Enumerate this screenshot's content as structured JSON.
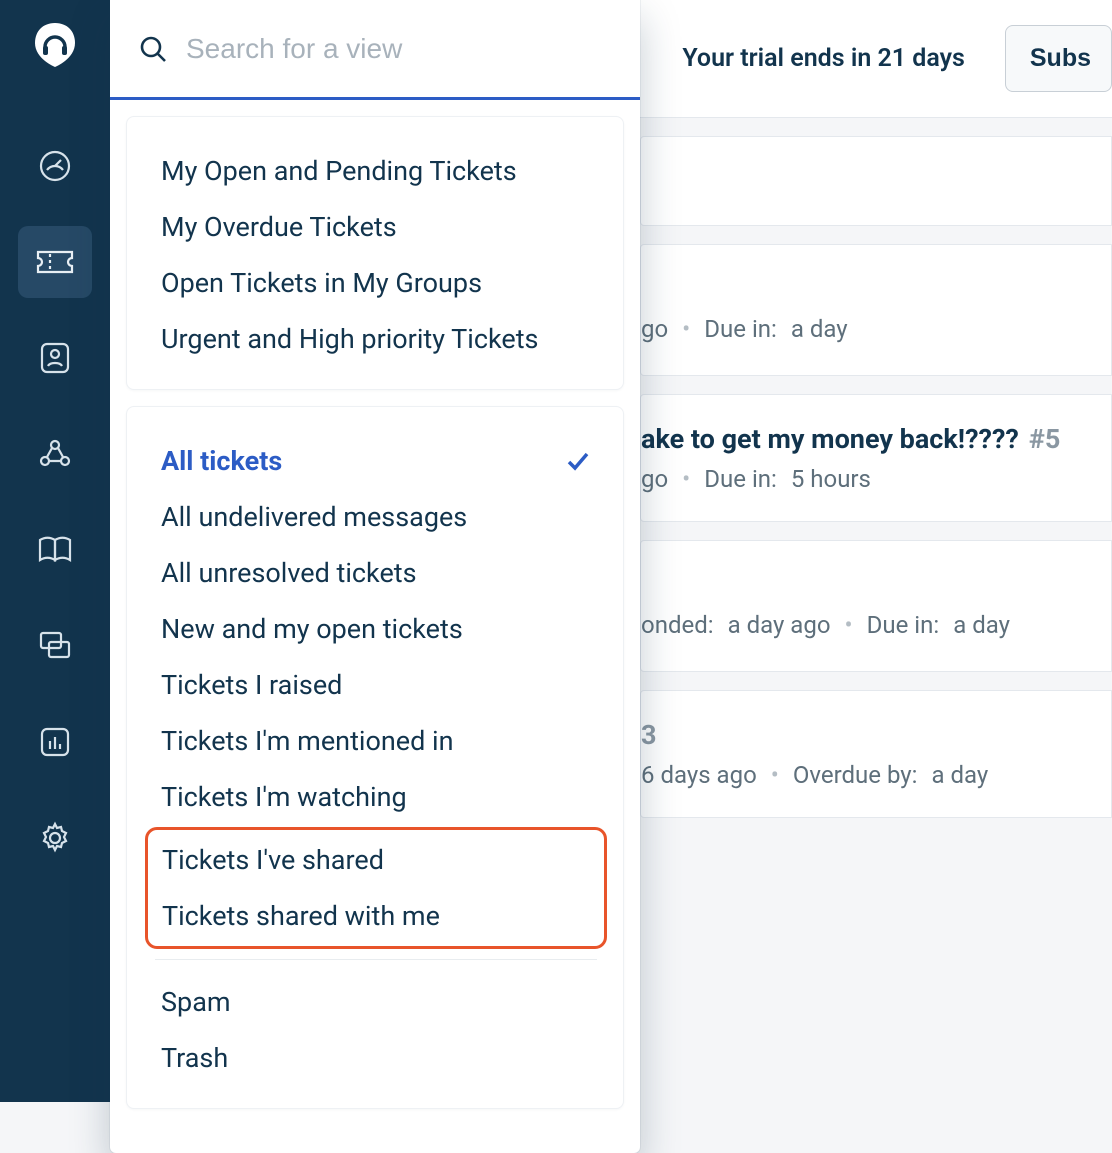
{
  "trial": {
    "text": "Your trial ends in 21 days"
  },
  "subscribe": {
    "label": "Subs"
  },
  "search": {
    "placeholder": "Search for a view"
  },
  "group_a": [
    "My Open and Pending Tickets",
    "My Overdue Tickets",
    "Open Tickets in My Groups",
    "Urgent and High priority Tickets"
  ],
  "group_b_selected": "All tickets",
  "group_b": [
    "All undelivered messages",
    "All unresolved tickets",
    "New and my open tickets",
    "Tickets I raised",
    "Tickets I'm mentioned in",
    "Tickets I'm watching"
  ],
  "group_b_highlight": [
    "Tickets I've shared",
    "Tickets shared with me"
  ],
  "group_b_tail": [
    "Spam",
    "Trash"
  ],
  "tickets": {
    "t1": {
      "meta_left": "go",
      "due_label": "Due in:",
      "due_val": "a day"
    },
    "t2": {
      "title_fragment": "ake to get my money back!????",
      "id": "#5",
      "meta_left": "go",
      "due_label": "Due in:",
      "due_val": "5 hours"
    },
    "t3": {
      "responded_label": "onded:",
      "responded_val": "a day ago",
      "due_label": "Due in:",
      "due_val": "a day"
    },
    "t4": {
      "id_fragment": "3",
      "meta_left": "6 days ago",
      "overdue_label": "Overdue by:",
      "overdue_val": "a day"
    }
  }
}
